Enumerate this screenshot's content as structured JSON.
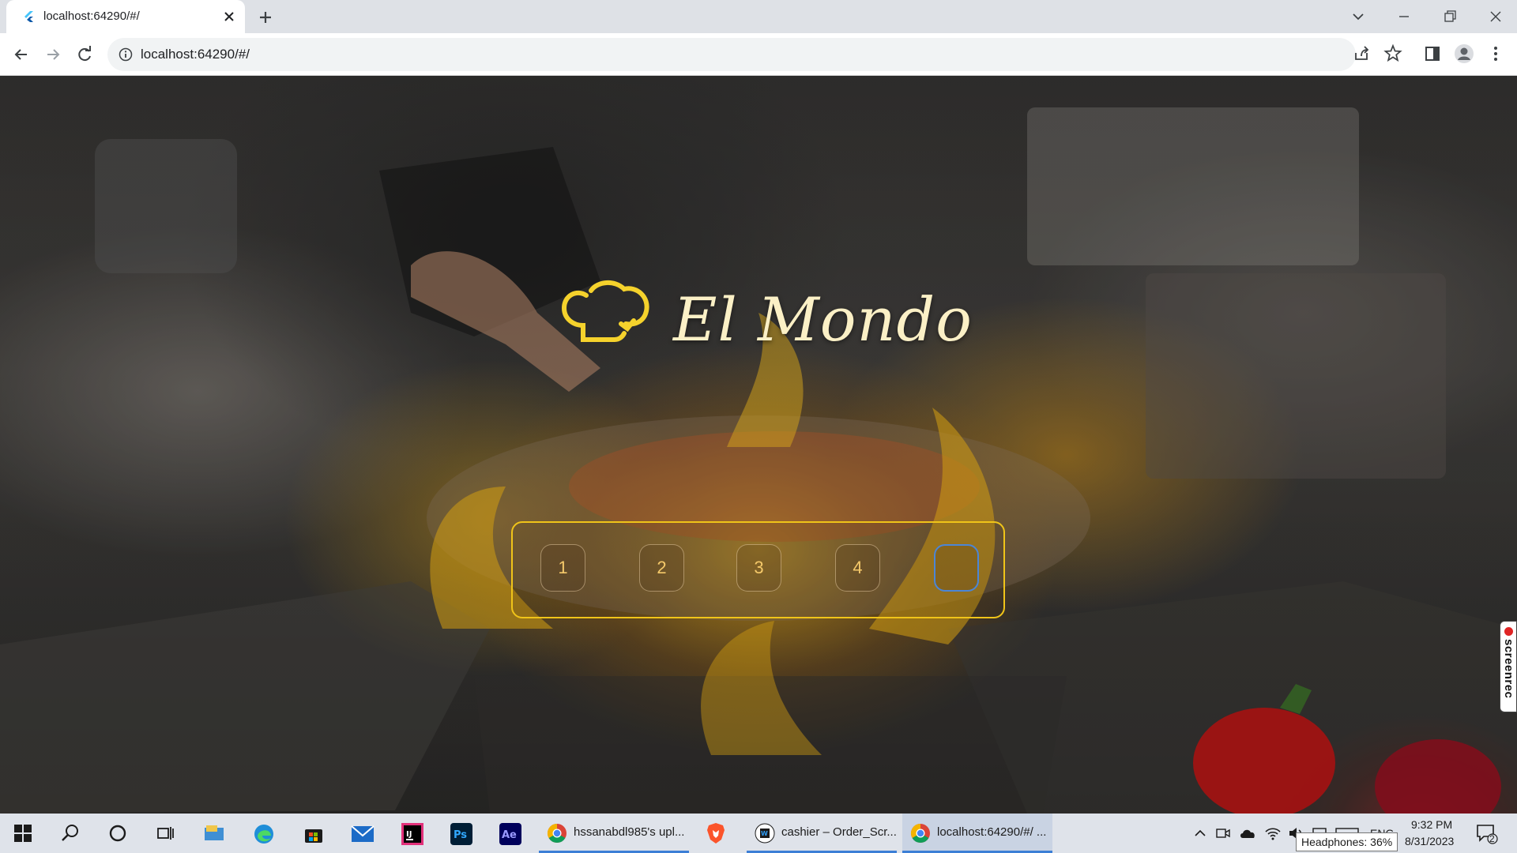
{
  "browser": {
    "tab_title": "localhost:64290/#/",
    "url": "localhost:64290/#/"
  },
  "page": {
    "brand_name": "El Mondo",
    "pin_slots": [
      "1",
      "2",
      "3",
      "4",
      ""
    ]
  },
  "overlay": {
    "screenrec_label": "screenrec"
  },
  "taskbar": {
    "apps": [
      {
        "label": "hssanabdl985's upl...",
        "icon": "chrome-icon"
      },
      {
        "label": "cashier – Order_Scr...",
        "icon": "webstorm-icon"
      },
      {
        "label": "localhost:64290/#/ ...",
        "icon": "chrome-icon"
      }
    ],
    "pinned_icons": [
      "windows-start-icon",
      "search-icon",
      "cortana-icon",
      "task-view-icon",
      "file-explorer-icon",
      "edge-icon",
      "store-icon",
      "mail-icon",
      "intellij-icon",
      "photoshop-icon",
      "after-effects-icon",
      "brave-icon"
    ],
    "language": "ENG",
    "time": "9:32 PM",
    "date": "8/31/2023",
    "notifications_count": "2",
    "tooltip": "Headphones: 36%"
  },
  "colors": {
    "accent_gold": "#f0c419",
    "brand_text": "#fbf0c6",
    "active_pin_border": "#4b86d6"
  }
}
